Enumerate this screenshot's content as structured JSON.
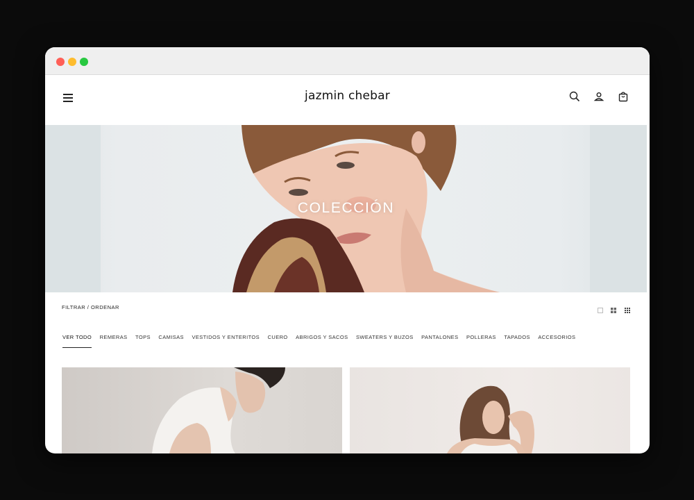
{
  "header": {
    "brand": "jazmin chebar",
    "icons": [
      "menu-icon",
      "search-icon",
      "user-icon",
      "bag-icon"
    ]
  },
  "hero": {
    "title": "COLECCIÓN"
  },
  "toolbar": {
    "filter_label": "FILTRAR / ORDENAR",
    "grid_options": [
      "grid-1-icon",
      "grid-2-icon",
      "grid-3-icon"
    ]
  },
  "categories": [
    {
      "label": "VER TODO",
      "active": true
    },
    {
      "label": "REMERAS"
    },
    {
      "label": "TOPS"
    },
    {
      "label": "CAMISAS"
    },
    {
      "label": "VESTIDOS Y ENTERITOS"
    },
    {
      "label": "CUERO"
    },
    {
      "label": "ABRIGOS Y SACOS"
    },
    {
      "label": "SWEATERS Y BUZOS"
    },
    {
      "label": "PANTALONES"
    },
    {
      "label": "POLLERAS"
    },
    {
      "label": "TAPADOS"
    },
    {
      "label": "ACCESORIOS"
    }
  ],
  "colors": {
    "page_bg": "#0b0b0b",
    "hero_bg": "#e9ecee",
    "text": "#111111"
  }
}
